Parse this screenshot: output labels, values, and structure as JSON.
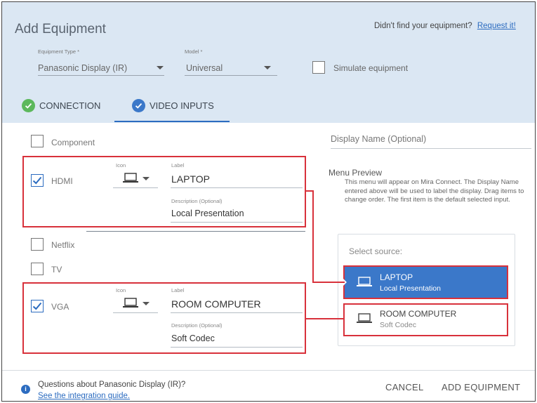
{
  "header": {
    "title": "Add Equipment",
    "didnt_find": "Didn't find your equipment?",
    "request_link": "Request it!"
  },
  "fields": {
    "equipment_type": {
      "label": "Equipment Type *",
      "value": "Panasonic Display (IR)"
    },
    "model": {
      "label": "Model *",
      "value": "Universal"
    },
    "simulate": {
      "label": "Simulate equipment",
      "checked": false
    }
  },
  "tabs": [
    {
      "label": "CONNECTION",
      "state": "complete"
    },
    {
      "label": "VIDEO INPUTS",
      "state": "active"
    }
  ],
  "inputs": {
    "component": {
      "name": "Component",
      "checked": false
    },
    "hdmi": {
      "name": "HDMI",
      "checked": true,
      "icon_label": "Icon",
      "icon": "laptop-icon",
      "label_caption": "Label",
      "label_value": "LAPTOP",
      "desc_caption": "Description (Optional)",
      "desc_value": "Local Presentation"
    },
    "netflix": {
      "name": "Netflix",
      "checked": false
    },
    "tv": {
      "name": "TV",
      "checked": false
    },
    "vga": {
      "name": "VGA",
      "checked": true,
      "icon_label": "Icon",
      "icon": "laptop-icon",
      "label_caption": "Label",
      "label_value": "ROOM COMPUTER",
      "desc_caption": "Description (Optional)",
      "desc_value": "Soft Codec"
    }
  },
  "right_panel": {
    "display_name_placeholder": "Display Name (Optional)",
    "menu_preview_title": "Menu Preview",
    "menu_preview_text": "This menu will appear on Mira Connect.  The Display Name entered above will be used to label the display. Drag items to change order. The first item is the default selected input.",
    "select_source": "Select source:",
    "items": [
      {
        "title": "LAPTOP",
        "subtitle": "Local Presentation",
        "selected": true
      },
      {
        "title": "ROOM COMPUTER",
        "subtitle": "Soft Codec",
        "selected": false
      }
    ]
  },
  "footer": {
    "question": "Questions about Panasonic Display (IR)?",
    "guide_link": "See the integration guide.",
    "cancel": "CANCEL",
    "add": "ADD EQUIPMENT"
  },
  "colors": {
    "header_bg": "#dbe7f3",
    "accent_blue": "#2c6cc0",
    "selected_item": "#3b78c9",
    "success_green": "#5cb85c",
    "annotation_red": "#d8313b"
  }
}
